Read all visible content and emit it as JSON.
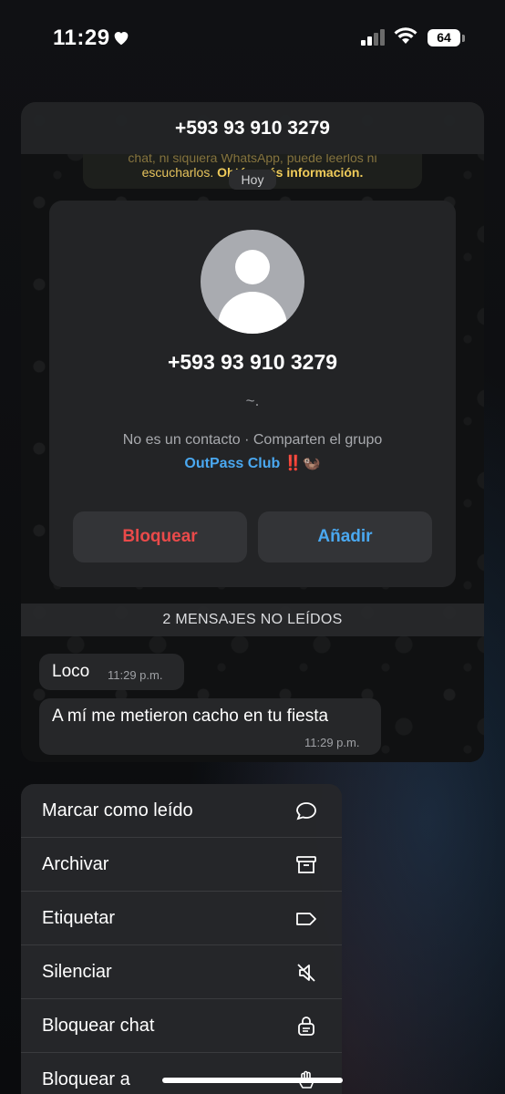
{
  "status_bar": {
    "time": "11:29",
    "battery": "64"
  },
  "chat": {
    "header_title": "+593 93 910 3279",
    "info_strip_faded": "chat, ni siquiera WhatsApp, puede leerlos ni",
    "info_strip_text": "escucharlos.",
    "info_strip_link": "Obtén más información.",
    "date_chip": "Hoy",
    "contact_card": {
      "phone": "+593 93 910 3279",
      "name": "~.",
      "subtitle": "No es un contacto · Comparten el grupo",
      "group_name": "OutPass Club",
      "group_emoji": "‼️🦦",
      "block_label": "Bloquear",
      "add_label": "Añadir"
    },
    "unread_label": "2 MENSAJES NO LEÍDOS",
    "messages": [
      {
        "text": "Loco",
        "time": "11:29 p.m."
      },
      {
        "text": "A mí me metieron cacho en tu fiesta",
        "time": "11:29 p.m."
      }
    ]
  },
  "menu": {
    "items": [
      {
        "label": "Marcar como leído",
        "icon": "chat-bubble-icon"
      },
      {
        "label": "Archivar",
        "icon": "archive-box-icon"
      },
      {
        "label": "Etiquetar",
        "icon": "tag-label-icon"
      },
      {
        "label": "Silenciar",
        "icon": "speaker-mute-icon"
      },
      {
        "label": "Bloquear chat",
        "icon": "lock-chat-icon"
      },
      {
        "label": "Bloquear a",
        "icon": "hand-stop-icon"
      }
    ]
  },
  "colors": {
    "red_action": "#ea4a4a",
    "blue_action": "#4aa8f0",
    "info_yellow": "#e6c35c"
  }
}
